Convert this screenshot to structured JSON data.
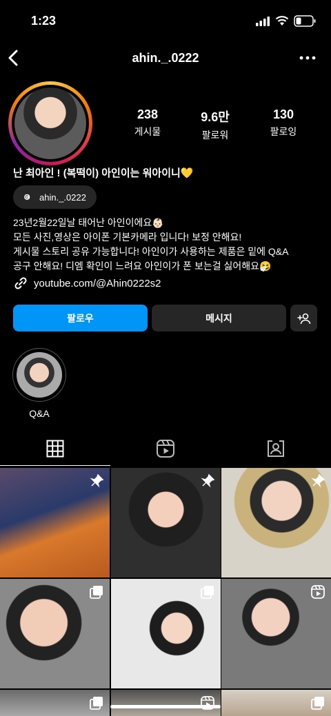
{
  "status_bar": {
    "time": "1:23"
  },
  "header": {
    "username": "ahin._.0222"
  },
  "profile": {
    "stats": [
      {
        "value": "238",
        "label": "게시물"
      },
      {
        "value": "9.6만",
        "label": "팔로워"
      },
      {
        "value": "130",
        "label": "팔로잉"
      }
    ],
    "name": "난 최아인 ! (복떡이) 아인이는 워아이니💛",
    "threads_handle": "ahin._.0222",
    "bio_lines": [
      "23년2월22일날 태어난 아인이에요👶🏻",
      "모든 사진,영상은 아이폰 기본카메라 입니다! 보정 안해요!",
      "게시물 스토리 공유 가능합니다! 아인이가 사용하는 제품은 밑에 Q&A",
      "공구 안해요! 디엠 확인이 느려요 아인이가 폰 보는걸 싫어해요🤧"
    ],
    "link": "youtube.com/@Ahin0222s2"
  },
  "actions": {
    "follow": "팔로우",
    "message": "메시지"
  },
  "highlights": [
    {
      "label": "Q&A"
    }
  ],
  "tabs": [
    "posts-grid",
    "reels",
    "tagged"
  ],
  "grid": [
    {
      "badge": "pin"
    },
    {
      "badge": "pin"
    },
    {
      "badge": "pin"
    },
    {
      "badge": "multi"
    },
    {
      "badge": "multi"
    },
    {
      "badge": "reel"
    },
    {
      "badge": "multi"
    },
    {
      "badge": "reel"
    },
    {
      "badge": "multi"
    }
  ],
  "colors": {
    "accent": "#0095f6",
    "button_bg": "#262626",
    "background": "#000000"
  }
}
